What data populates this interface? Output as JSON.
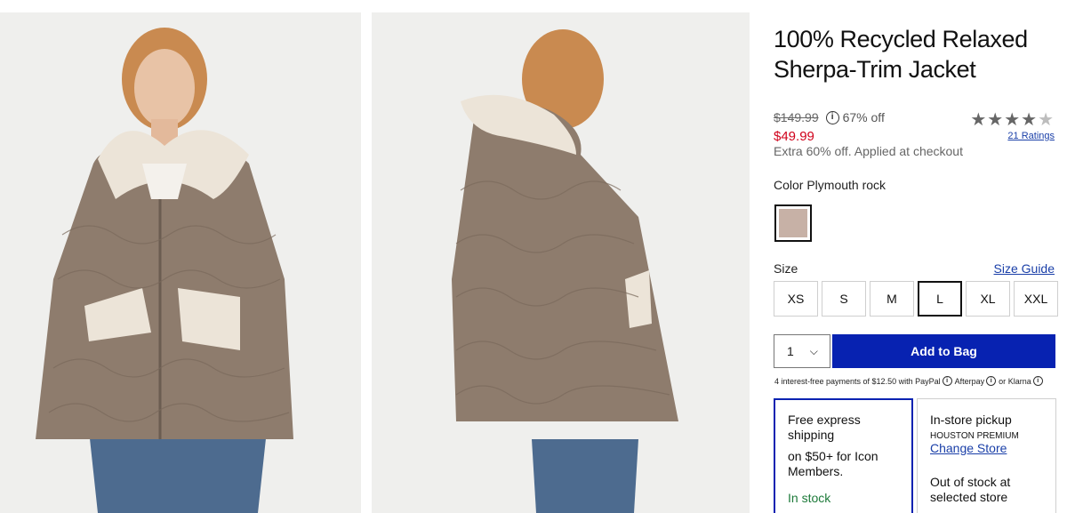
{
  "product": {
    "title": "100% Recycled Relaxed Sherpa-Trim Jacket",
    "original_price": "$149.99",
    "discount": "67% off",
    "sale_price": "$49.99",
    "promo": "Extra 60% off. Applied at checkout",
    "rating": 4,
    "rating_max": 5,
    "ratings_link": "21 Ratings"
  },
  "color": {
    "label": "Color Plymouth rock",
    "swatch": "#c7b1a6"
  },
  "size": {
    "label": "Size",
    "guide_link": "Size Guide",
    "options": [
      "XS",
      "S",
      "M",
      "L",
      "XL",
      "XXL"
    ],
    "selected": "L"
  },
  "cart": {
    "quantity": "1",
    "add_label": "Add to Bag",
    "accent": "#0722b1"
  },
  "bnpl": {
    "prefix": "4 interest-free payments of $12.50 with",
    "paypal": "PayPal",
    "afterpay": "Afterpay",
    "or": "or",
    "klarna": "Klarna"
  },
  "shipping": {
    "title": "Free express shipping",
    "sub": "on $50+ for Icon Members.",
    "status": "In stock"
  },
  "pickup": {
    "title": "In-store pickup",
    "store": "HOUSTON PREMIUM",
    "change": "Change Store",
    "status": "Out of stock at selected store"
  },
  "icons": {
    "info": "info-icon",
    "star": "star-icon",
    "chevron": "chevron-down-icon"
  },
  "colors": {
    "sale": "#d0021b",
    "link": "#1a3fa8",
    "in_stock": "#1d7a3a"
  }
}
